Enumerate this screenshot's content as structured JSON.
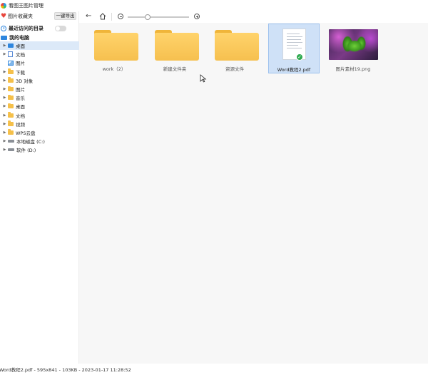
{
  "app": {
    "title": "看图王图片管理"
  },
  "sidebar": {
    "favorites_label": "图片收藏夹",
    "export_button": "一键导出",
    "recent_label": "最近访问的目录",
    "recent_toggle_on": false,
    "pc_label": "我的电脑",
    "items": [
      {
        "label": "桌面",
        "icon": "desktop-icon",
        "selected": true
      },
      {
        "label": "文档",
        "icon": "document-icon",
        "selected": false
      },
      {
        "label": "图片",
        "icon": "picture-icon",
        "selected": false
      },
      {
        "label": "下载",
        "icon": "folder-icon",
        "selected": false
      },
      {
        "label": "3D 对象",
        "icon": "folder-icon",
        "selected": false
      },
      {
        "label": "图片",
        "icon": "folder-icon",
        "selected": false
      },
      {
        "label": "音乐",
        "icon": "folder-icon",
        "selected": false
      },
      {
        "label": "桌面",
        "icon": "folder-icon",
        "selected": false
      },
      {
        "label": "文档",
        "icon": "folder-icon",
        "selected": false
      },
      {
        "label": "视频",
        "icon": "folder-icon",
        "selected": false
      },
      {
        "label": "WPS云盘",
        "icon": "folder-icon",
        "selected": false
      },
      {
        "label": "本地磁盘 (C:)",
        "icon": "drive-icon",
        "selected": false
      },
      {
        "label": "软件 (D:)",
        "icon": "drive-icon",
        "selected": false
      }
    ]
  },
  "toolbar": {
    "zoom_level": 0.33
  },
  "files": [
    {
      "name": "work（2）",
      "type": "folder",
      "selected": false
    },
    {
      "name": "新建文件夹",
      "type": "folder",
      "selected": false
    },
    {
      "name": "资源文件",
      "type": "folder",
      "selected": false
    },
    {
      "name": "Word教程2.pdf",
      "type": "pdf",
      "selected": true
    },
    {
      "name": "图片素材19.png",
      "type": "image",
      "selected": false
    }
  ],
  "status": {
    "text": "Word教程2.pdf - 595x841 - 103KB - 2023-01-17 11:28:52"
  },
  "colors": {
    "accent": "#2e86de",
    "selection": "#cfe1f7",
    "folder": "#f6c04f",
    "check": "#2eaa4f"
  }
}
